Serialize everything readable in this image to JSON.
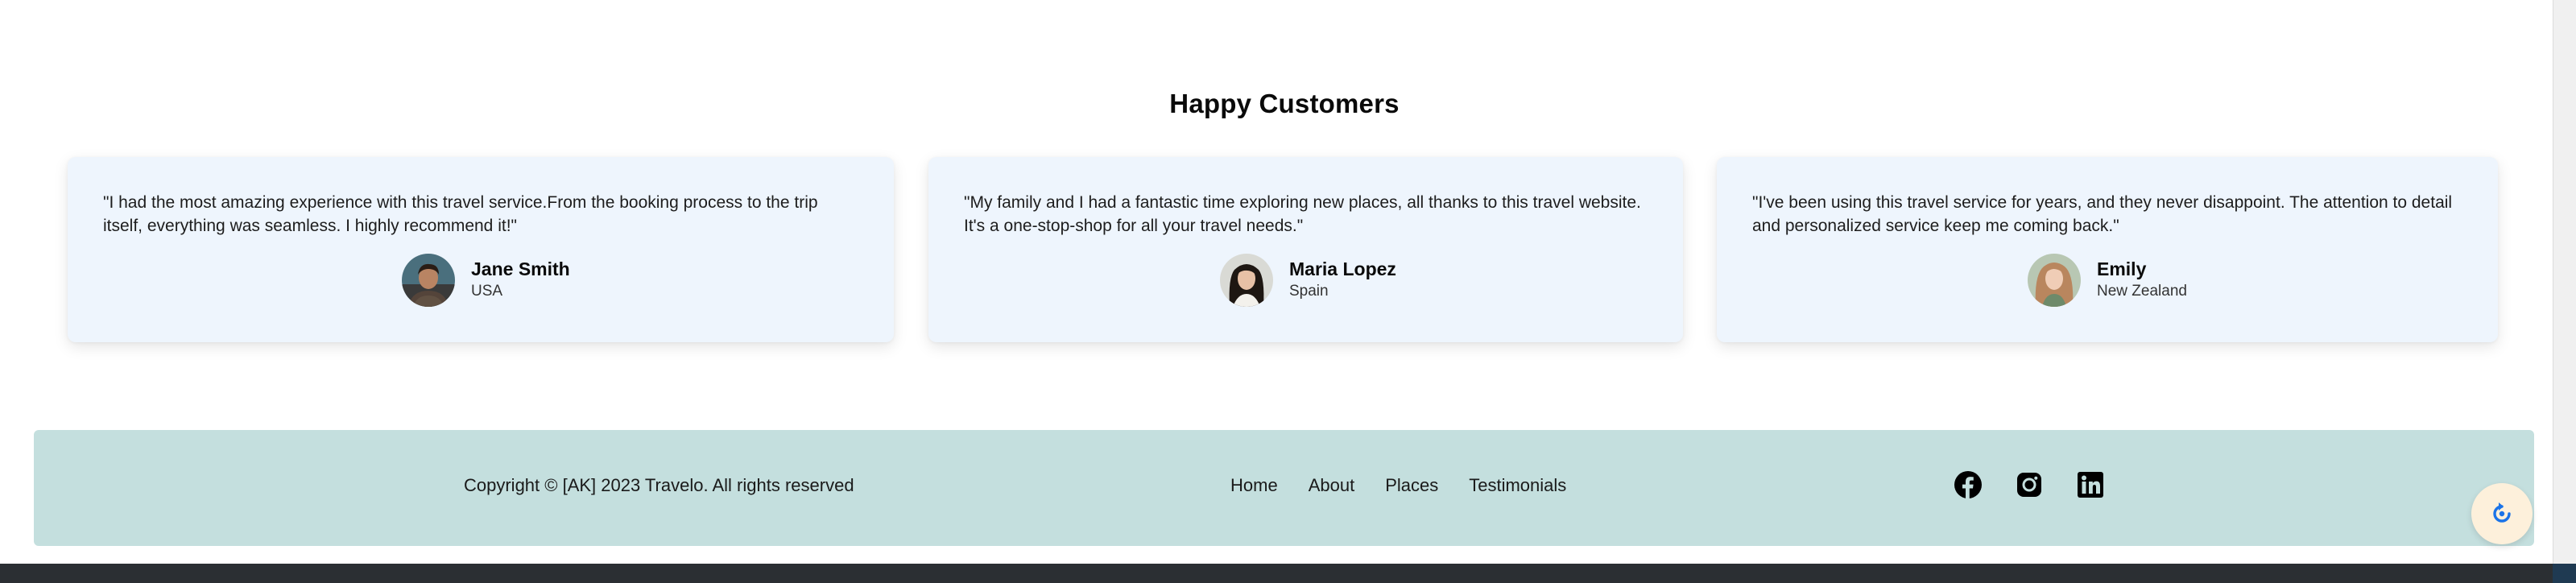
{
  "testimonials": {
    "title": "Happy Customers",
    "items": [
      {
        "quote": "\"I had the most amazing experience with this travel service.From the booking process to the trip itself, everything was seamless. I highly recommend it!\"",
        "name": "Jane Smith",
        "country": "USA"
      },
      {
        "quote": "\"My family and I had a fantastic time exploring new places, all thanks to this travel website. It's a one-stop-shop for all your travel needs.\"",
        "name": "Maria Lopez",
        "country": "Spain"
      },
      {
        "quote": "\"I've been using this travel service for years, and they never disappoint. The attention to detail and personalized service keep me coming back.\"",
        "name": "Emily",
        "country": "New Zealand"
      }
    ]
  },
  "footer": {
    "copyright": "Copyright © [AK] 2023 Travelo. All rights reserved",
    "nav": [
      "Home",
      "About",
      "Places",
      "Testimonials"
    ],
    "social": [
      "facebook-icon",
      "instagram-icon",
      "linkedin-icon"
    ]
  },
  "fab": {
    "icon": "refresh-icon"
  },
  "colors": {
    "card_bg": "#eef5fd",
    "footer_bg": "#c4dfde",
    "fab_bg": "#fdf0db",
    "fab_icon": "#1a73e8"
  }
}
